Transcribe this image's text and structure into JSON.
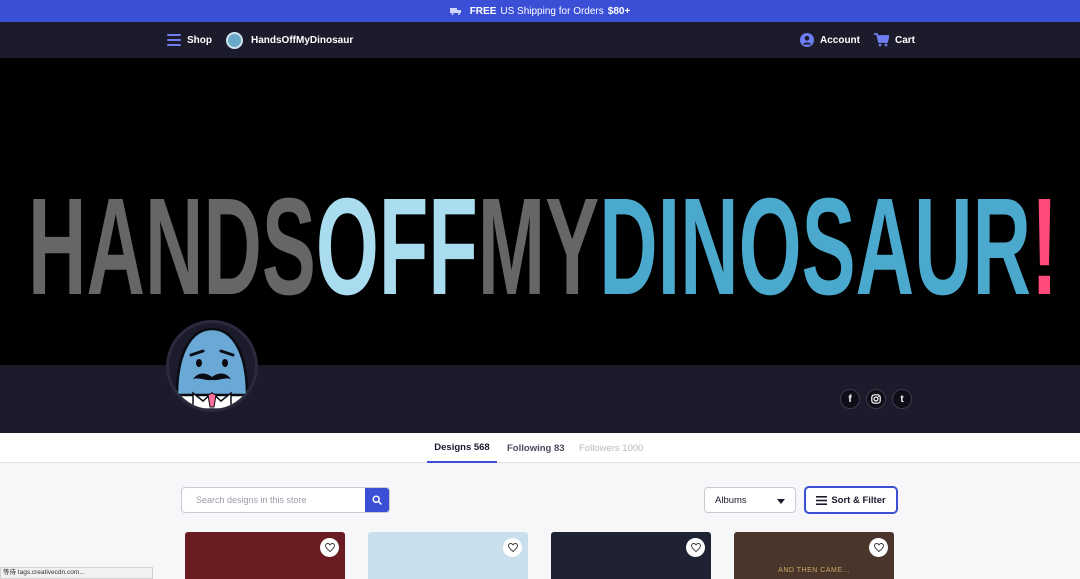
{
  "promo": {
    "free": "FREE",
    "text": "US Shipping for Orders",
    "amount": "$80+"
  },
  "nav": {
    "shop_label": "Shop",
    "brand": "HandsOffMyDinosaur",
    "account_label": "Account",
    "cart_label": "Cart"
  },
  "banner": {
    "part1": "HANDS",
    "part2": "OFF",
    "part3": "MY",
    "part4": "DINOSAUR",
    "part5": "!"
  },
  "social": {
    "facebook": "f",
    "tumblr": "t"
  },
  "tabs": [
    {
      "label": "Designs 568"
    },
    {
      "label": "Following 83"
    },
    {
      "label": "Followers 1000"
    }
  ],
  "search": {
    "placeholder": "Search designs in this store"
  },
  "filters": {
    "albums_value": "Albums",
    "sort_label": "Sort & Filter"
  },
  "cards": [
    {
      "color": "#6b1c22",
      "caption": ""
    },
    {
      "color": "#c9e0ec",
      "caption": ""
    },
    {
      "color": "#1f2233",
      "caption": ""
    },
    {
      "color": "#4a352a",
      "caption": "AND THEN CAME..."
    }
  ],
  "status": {
    "text": "等待 tags.creativecdn.com..."
  },
  "colors": {
    "accent": "#3a4fd6",
    "banner_gray": "#666666",
    "banner_light_blue": "#a9dcef",
    "banner_blue": "#4aa9cc",
    "banner_pink": "#ff4a7a"
  }
}
